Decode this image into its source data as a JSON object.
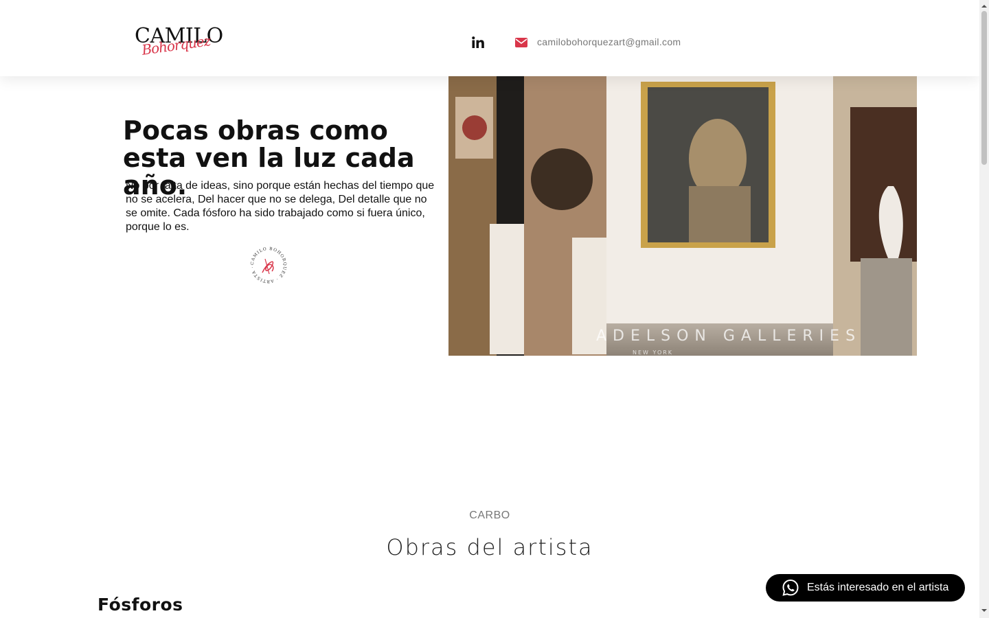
{
  "header": {
    "logo_main": "CAMILO",
    "logo_script": "Bohorquez",
    "email": "camilobohorquezart@gmail.com",
    "icons": [
      "linkedin-icon",
      "envelope-icon"
    ],
    "colors": {
      "accent": "#d9364a",
      "text_muted": "#777777"
    }
  },
  "hero": {
    "title": "Pocas obras como esta ven la luz cada año.",
    "text": "No por falta de ideas, sino porque están hechas del tiempo que no se acelera, Del hacer que no se delega, Del detalle que no se omite. Cada fósforo ha sido trabajado como si fuera único, porque lo es.",
    "signature_text": "CAMILO BOHORQUEZ · ARTISTA ·",
    "photo_caption": "ADELSON GALLERIES",
    "photo_subcaption": "NEW YORK"
  },
  "section": {
    "kicker": "CARBO",
    "title": "Obras del artista",
    "subtitle": "Fósforos"
  },
  "whatsapp": {
    "label": "Estás interesado en el artista",
    "icon": "whatsapp-icon",
    "color": "#000000"
  }
}
